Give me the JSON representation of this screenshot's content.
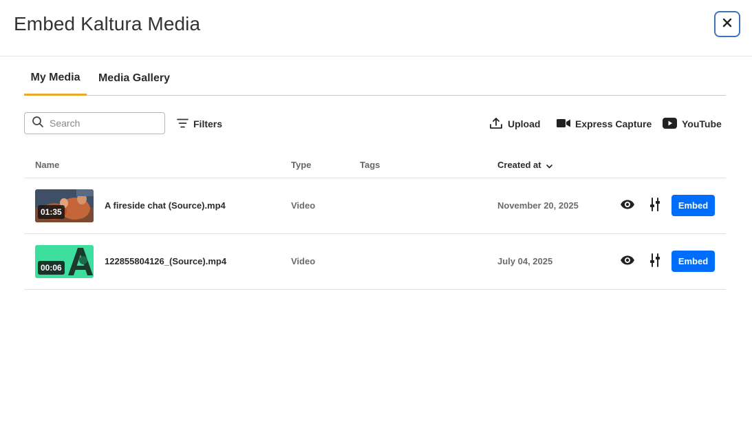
{
  "dialog": {
    "title": "Embed Kaltura Media",
    "close_label": "×"
  },
  "tabs": [
    {
      "label": "My Media",
      "active": true
    },
    {
      "label": "Media Gallery",
      "active": false
    }
  ],
  "toolbar": {
    "search_placeholder": "Search",
    "search_value": "",
    "filters_label": "Filters",
    "upload_label": "Upload",
    "express_capture_label": "Express Capture",
    "youtube_label": "YouTube"
  },
  "table": {
    "columns": {
      "name": "Name",
      "type": "Type",
      "tags": "Tags",
      "created_at": "Created at"
    },
    "sort": {
      "column": "created_at",
      "direction": "desc"
    },
    "rows": [
      {
        "duration": "01:35",
        "name": "A fireside chat (Source).mp4",
        "type": "Video",
        "tags": "",
        "created": "November 20, 2025",
        "embed_label": "Embed",
        "thumb": "warm-scene"
      },
      {
        "duration": "00:06",
        "name": "122855804126_(Source).mp4",
        "type": "Video",
        "tags": "",
        "created": "July 04, 2025",
        "embed_label": "Embed",
        "thumb": "green-logo"
      }
    ]
  },
  "colors": {
    "accent_tab": "#e9a825",
    "embed_button": "#006efa",
    "close_border": "#3b73b9"
  }
}
